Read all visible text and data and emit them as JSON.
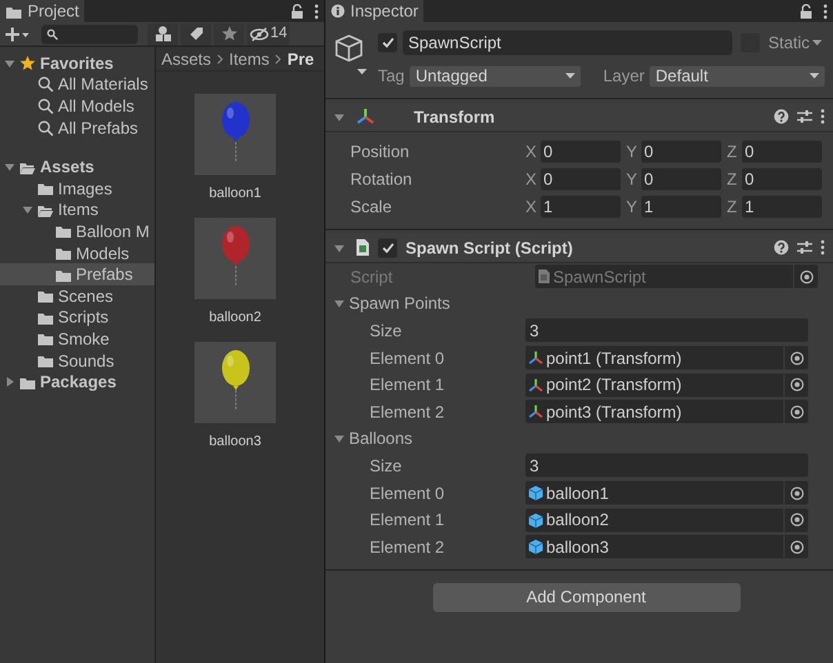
{
  "project": {
    "tab": "Project",
    "hidden_count": "14",
    "tree": [
      {
        "label": "Favorites",
        "kind": "star",
        "expanded": true,
        "selected": false,
        "children": [
          {
            "label": "All Materials",
            "kind": "search",
            "selected": false
          },
          {
            "label": "All Models",
            "kind": "search",
            "selected": false
          },
          {
            "label": "All Prefabs",
            "kind": "search",
            "selected": false
          }
        ]
      },
      {
        "label": "Assets",
        "kind": "folder",
        "expanded": true,
        "selected": false,
        "children": [
          {
            "label": "Images",
            "kind": "folder",
            "selected": false
          },
          {
            "label": "Items",
            "kind": "folder",
            "expanded": true,
            "selected": false,
            "children": [
              {
                "label": "Balloon M",
                "kind": "folder",
                "selected": false
              },
              {
                "label": "Models",
                "kind": "folder",
                "selected": false
              },
              {
                "label": "Prefabs",
                "kind": "folder",
                "selected": true
              }
            ]
          },
          {
            "label": "Scenes",
            "kind": "folder",
            "selected": false
          },
          {
            "label": "Scripts",
            "kind": "folder",
            "selected": false
          },
          {
            "label": "Smoke",
            "kind": "folder",
            "selected": false
          },
          {
            "label": "Sounds",
            "kind": "folder",
            "selected": false
          }
        ]
      },
      {
        "label": "Packages",
        "kind": "folder",
        "expanded": false,
        "selected": false
      }
    ],
    "breadcrumb": [
      "Assets",
      "Items",
      "Pre"
    ],
    "assets": [
      {
        "name": "balloon1",
        "color": "#2233cc"
      },
      {
        "name": "balloon2",
        "color": "#b0242c"
      },
      {
        "name": "balloon3",
        "color": "#c8c41c"
      }
    ]
  },
  "inspector": {
    "tab": "Inspector",
    "object": {
      "active": true,
      "name": "SpawnScript",
      "static": false,
      "static_label": "Static",
      "tag_label": "Tag",
      "tag": "Untagged",
      "layer_label": "Layer",
      "layer": "Default"
    },
    "transform": {
      "title": "Transform",
      "expanded": true,
      "rows": [
        {
          "label": "Position",
          "values": [
            {
              "axis": "X",
              "value": "0"
            },
            {
              "axis": "Y",
              "value": "0"
            },
            {
              "axis": "Z",
              "value": "0"
            }
          ]
        },
        {
          "label": "Rotation",
          "values": [
            {
              "axis": "X",
              "value": "0"
            },
            {
              "axis": "Y",
              "value": "0"
            },
            {
              "axis": "Z",
              "value": "0"
            }
          ]
        },
        {
          "label": "Scale",
          "values": [
            {
              "axis": "X",
              "value": "1"
            },
            {
              "axis": "Y",
              "value": "1"
            },
            {
              "axis": "Z",
              "value": "1"
            }
          ]
        }
      ]
    },
    "script_component": {
      "title": "Spawn Script (Script)",
      "enabled": true,
      "expanded": true,
      "script_field": {
        "label": "Script",
        "value": "SpawnScript",
        "disabled": true
      },
      "arrays": [
        {
          "label": "Spawn Points",
          "expanded": true,
          "size_label": "Size",
          "size": "3",
          "elements": [
            {
              "label": "Element 0",
              "value": "point1 (Transform)",
              "kind": "transform"
            },
            {
              "label": "Element 1",
              "value": "point2 (Transform)",
              "kind": "transform"
            },
            {
              "label": "Element 2",
              "value": "point3 (Transform)",
              "kind": "transform"
            }
          ]
        },
        {
          "label": "Balloons",
          "expanded": true,
          "size_label": "Size",
          "size": "3",
          "elements": [
            {
              "label": "Element 0",
              "value": "balloon1",
              "kind": "prefab"
            },
            {
              "label": "Element 1",
              "value": "balloon2",
              "kind": "prefab"
            },
            {
              "label": "Element 2",
              "value": "balloon3",
              "kind": "prefab"
            }
          ]
        }
      ]
    },
    "add_component": "Add Component"
  }
}
